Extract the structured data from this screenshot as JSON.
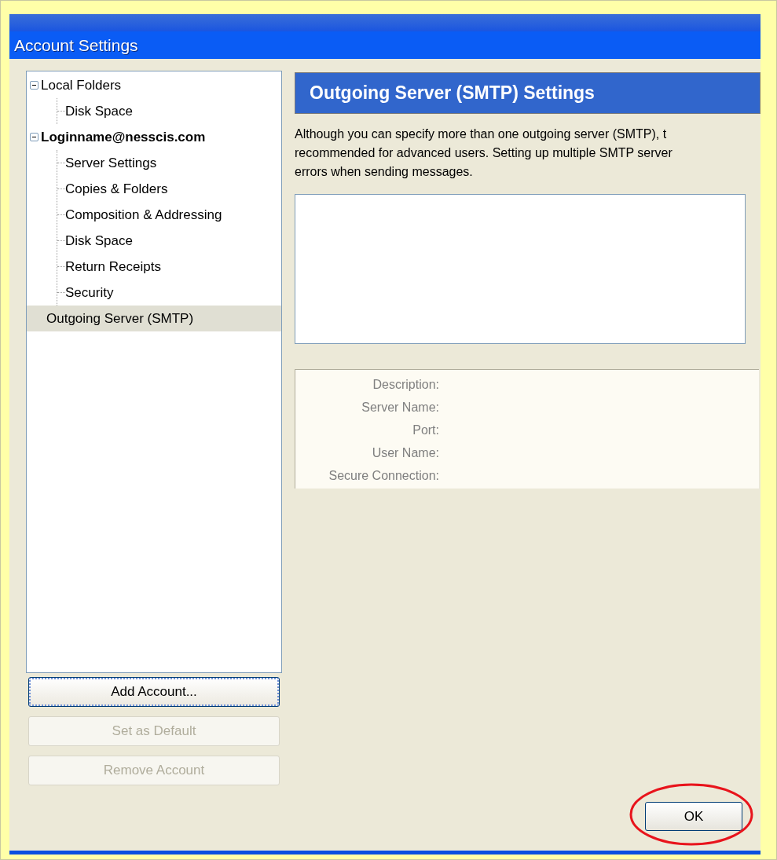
{
  "window": {
    "title": "Account Settings"
  },
  "tree": [
    {
      "label": "Local Folders",
      "kind": "folder",
      "expanded": true,
      "selected": false,
      "children": [
        {
          "label": "Disk Space",
          "selected": false
        }
      ]
    },
    {
      "label": "Loginname@nesscis.com",
      "kind": "account",
      "expanded": true,
      "selected": false,
      "children": [
        {
          "label": "Server Settings",
          "selected": false
        },
        {
          "label": "Copies & Folders",
          "selected": false
        },
        {
          "label": "Composition & Addressing",
          "selected": false
        },
        {
          "label": "Disk Space",
          "selected": false
        },
        {
          "label": "Return Receipts",
          "selected": false
        },
        {
          "label": "Security",
          "selected": false
        }
      ]
    },
    {
      "label": "Outgoing Server (SMTP)",
      "kind": "item",
      "selected": true
    }
  ],
  "account_buttons": [
    {
      "label": "Add Account...",
      "disabled": false,
      "focused": true
    },
    {
      "label": "Set as Default",
      "disabled": true,
      "focused": false
    },
    {
      "label": "Remove Account",
      "disabled": true,
      "focused": false
    }
  ],
  "panel": {
    "heading": "Outgoing Server (SMTP) Settings",
    "description": [
      "Although you can specify more than one outgoing server (SMTP), t",
      "recommended for advanced users. Setting up multiple SMTP server",
      "errors when sending messages."
    ],
    "details": [
      {
        "label": "Description:",
        "disabled": true
      },
      {
        "label": "Server Name:",
        "disabled": true
      },
      {
        "label": "Port:",
        "disabled": true
      },
      {
        "label": "User Name:",
        "disabled": true
      },
      {
        "label": "Secure Connection:",
        "disabled": true
      }
    ]
  },
  "ok_button": {
    "label": "OK",
    "highlighted": true
  }
}
